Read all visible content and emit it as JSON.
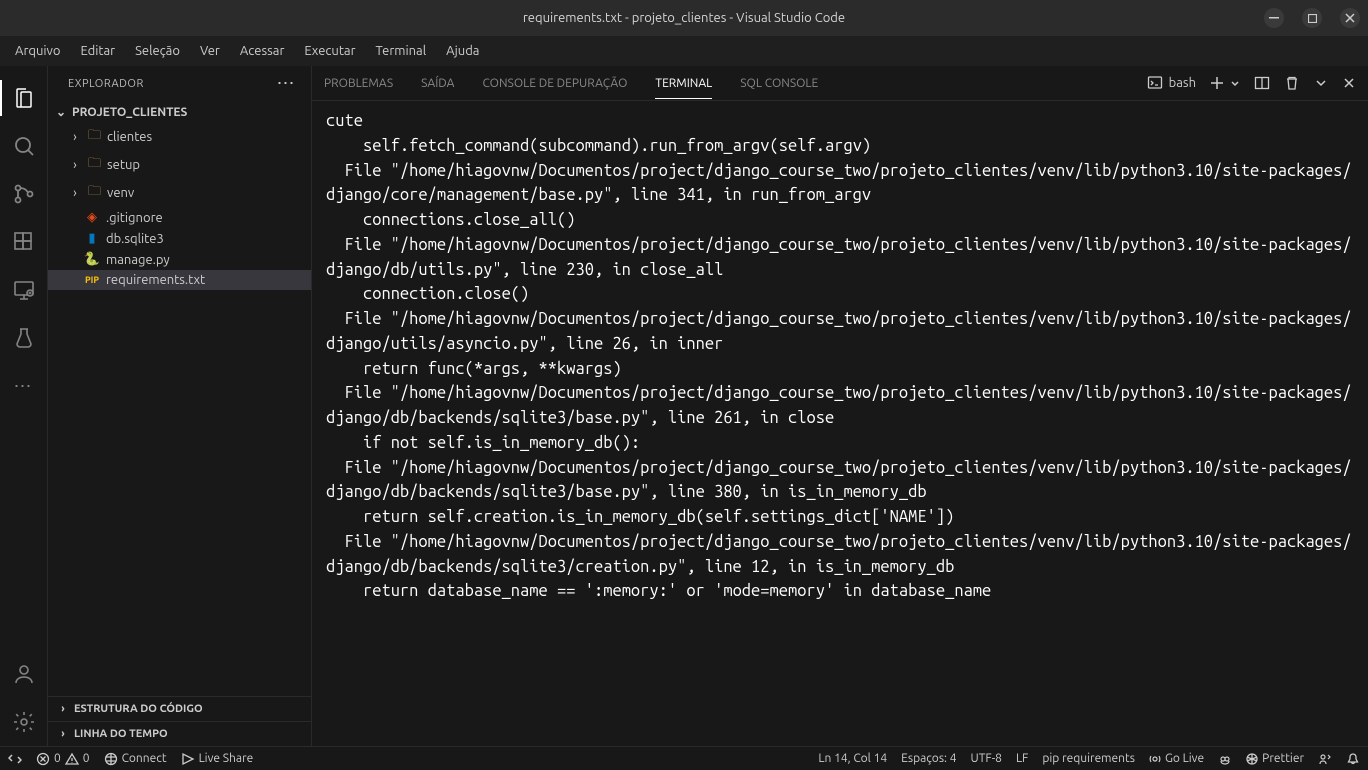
{
  "window": {
    "title": "requirements.txt - projeto_clientes - Visual Studio Code"
  },
  "menubar": {
    "items": [
      "Arquivo",
      "Editar",
      "Seleção",
      "Ver",
      "Acessar",
      "Executar",
      "Terminal",
      "Ajuda"
    ]
  },
  "sidebar": {
    "title": "EXPLORADOR",
    "project": "PROJETO_CLIENTES",
    "tree": {
      "folders": [
        "clientes",
        "setup",
        "venv"
      ],
      "files": [
        {
          "name": ".gitignore",
          "icon": "git"
        },
        {
          "name": "db.sqlite3",
          "icon": "db"
        },
        {
          "name": "manage.py",
          "icon": "py"
        },
        {
          "name": "requirements.txt",
          "icon": "pip",
          "selected": true
        }
      ]
    },
    "outline": "ESTRUTURA DO CÓDIGO",
    "timeline": "LINHA DO TEMPO"
  },
  "panel": {
    "tabs": [
      "PROBLEMAS",
      "SAÍDA",
      "CONSOLE DE DEPURAÇÃO",
      "TERMINAL",
      "SQL CONSOLE"
    ],
    "active_tab": "TERMINAL",
    "shell": "bash"
  },
  "terminal": {
    "lines": [
      "cute",
      "    self.fetch_command(subcommand).run_from_argv(self.argv)",
      "  File \"/home/hiagovnw/Documentos/project/django_course_two/projeto_clientes/venv/lib/python3.10/site-packages/django/core/management/base.py\", line 341, in run_from_argv",
      "    connections.close_all()",
      "  File \"/home/hiagovnw/Documentos/project/django_course_two/projeto_clientes/venv/lib/python3.10/site-packages/django/db/utils.py\", line 230, in close_all",
      "    connection.close()",
      "  File \"/home/hiagovnw/Documentos/project/django_course_two/projeto_clientes/venv/lib/python3.10/site-packages/django/utils/asyncio.py\", line 26, in inner",
      "    return func(*args, **kwargs)",
      "  File \"/home/hiagovnw/Documentos/project/django_course_two/projeto_clientes/venv/lib/python3.10/site-packages/django/db/backends/sqlite3/base.py\", line 261, in close",
      "    if not self.is_in_memory_db():",
      "  File \"/home/hiagovnw/Documentos/project/django_course_two/projeto_clientes/venv/lib/python3.10/site-packages/django/db/backends/sqlite3/base.py\", line 380, in is_in_memory_db",
      "    return self.creation.is_in_memory_db(self.settings_dict['NAME'])",
      "  File \"/home/hiagovnw/Documentos/project/django_course_two/projeto_clientes/venv/lib/python3.10/site-packages/django/db/backends/sqlite3/creation.py\", line 12, in is_in_memory_db",
      "    return database_name == ':memory:' or 'mode=memory' in database_name"
    ]
  },
  "statusbar": {
    "errors": "0",
    "warnings": "0",
    "connect": "Connect",
    "liveshare": "Live Share",
    "cursor": "Ln 14, Col 14",
    "spaces": "Espaços: 4",
    "encoding": "UTF-8",
    "eol": "LF",
    "language": "pip requirements",
    "golive": "Go Live",
    "prettier": "Prettier"
  }
}
